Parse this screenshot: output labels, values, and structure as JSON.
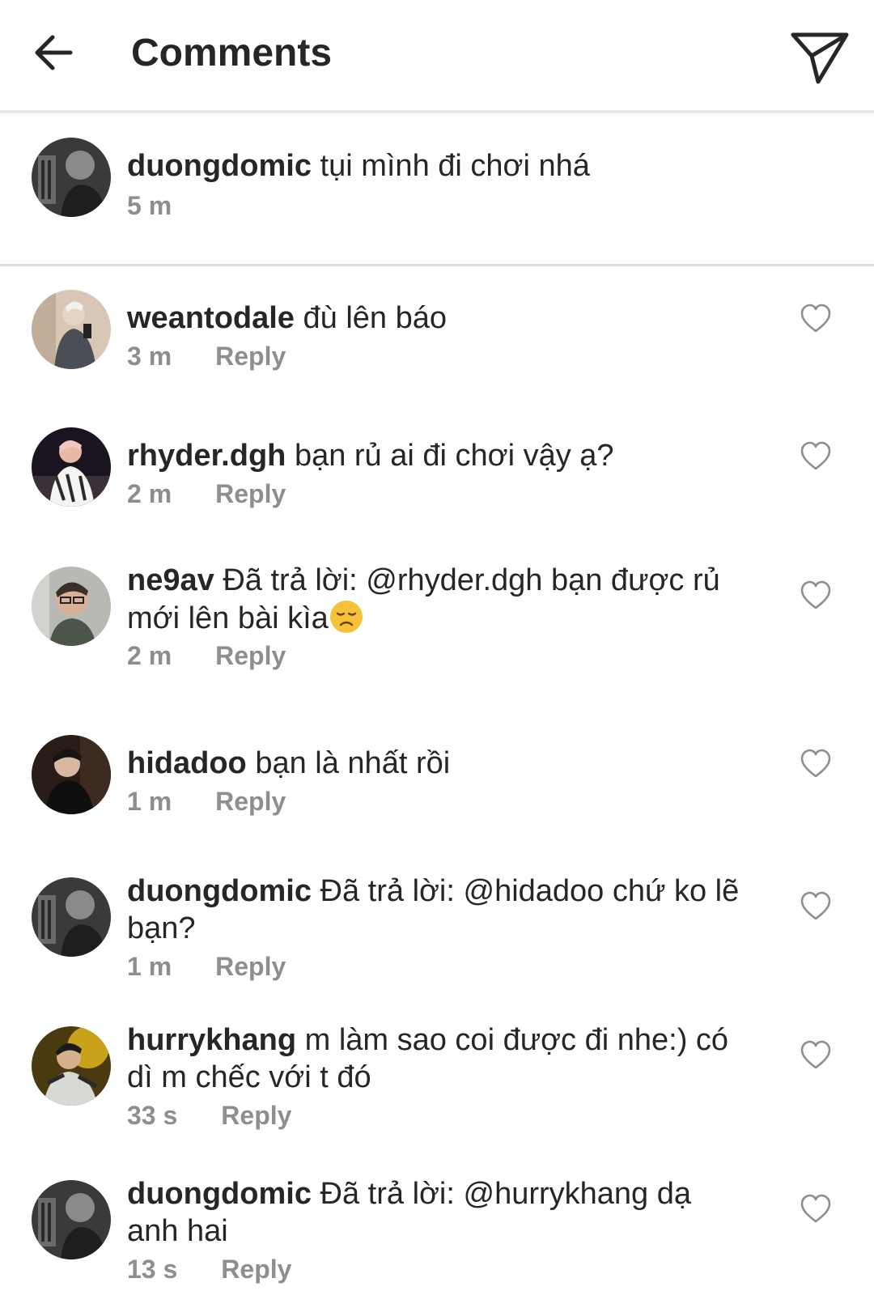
{
  "header": {
    "title": "Comments",
    "back_icon": "arrow-left-icon",
    "send_icon": "paper-plane-icon"
  },
  "caption": {
    "username": "duongdomic",
    "text": "tụi mình đi chơi nhá",
    "time": "5 m"
  },
  "comments": [
    {
      "username": "weantodale",
      "text": "đù lên báo",
      "time": "3 m",
      "reply_label": "Reply"
    },
    {
      "username": "rhyder.dgh",
      "text": "bạn rủ ai đi chơi vậy ạ?",
      "time": "2 m",
      "reply_label": "Reply"
    },
    {
      "username": "ne9av",
      "text": "Đã trả lời: @rhyder.dgh bạn được rủ mới lên bài kìa",
      "emoji": "disappointed-face-emoji",
      "time": "2 m",
      "reply_label": "Reply"
    },
    {
      "username": "hidadoo",
      "text": "bạn là nhất rồi",
      "time": "1 m",
      "reply_label": "Reply"
    },
    {
      "username": "duongdomic",
      "text": "Đã trả lời: @hidadoo chứ ko lẽ bạn?",
      "time": "1 m",
      "reply_label": "Reply"
    },
    {
      "username": "hurrykhang",
      "text": "m làm sao coi được đi nhe:) có dì m chếc với t đó",
      "time": "33 s",
      "reply_label": "Reply"
    },
    {
      "username": "duongdomic",
      "text": "Đã trả lời: @hurrykhang dạ anh hai",
      "time": "13 s",
      "reply_label": "Reply"
    }
  ],
  "colors": {
    "text": "#262626",
    "secondary": "#8e8e8e",
    "divider": "#dcdcdc"
  }
}
